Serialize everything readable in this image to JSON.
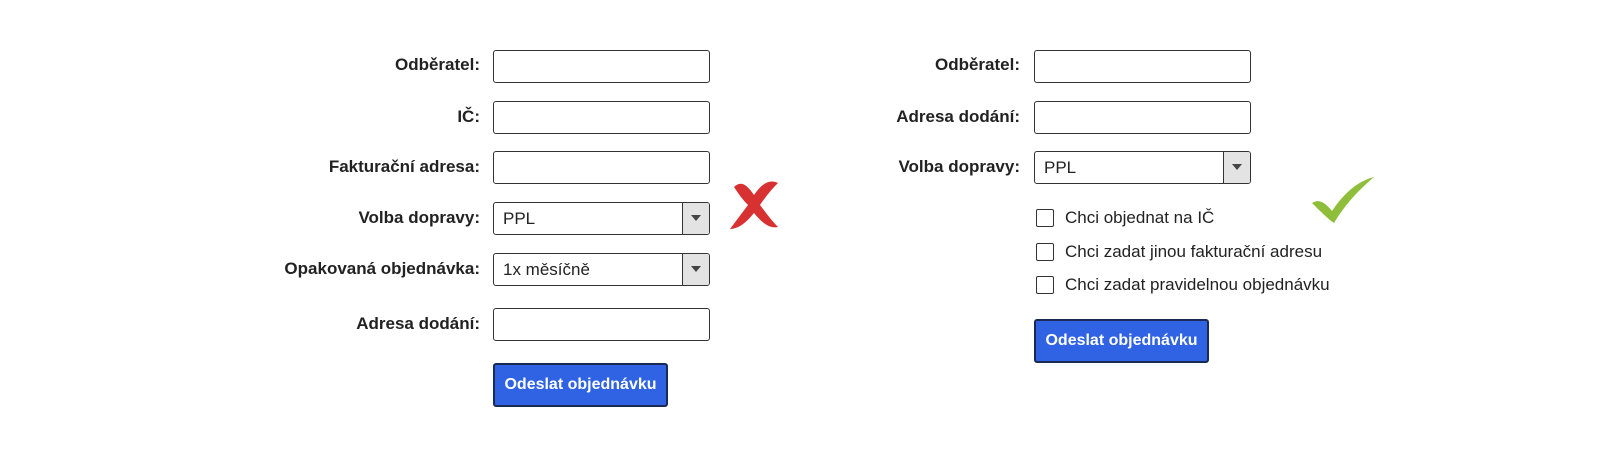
{
  "bad_form": {
    "fields": [
      {
        "label": "Odběratel:",
        "type": "text",
        "value": ""
      },
      {
        "label": "IČ:",
        "type": "text",
        "value": ""
      },
      {
        "label": "Fakturační adresa:",
        "type": "text",
        "value": ""
      },
      {
        "label": "Volba dopravy:",
        "type": "select",
        "value": "PPL"
      },
      {
        "label": "Opakovaná objednávka:",
        "type": "select",
        "value": "1x měsíčně"
      },
      {
        "label": "Adresa dodání:",
        "type": "text",
        "value": ""
      }
    ],
    "submit_label": "Odeslat objednávku",
    "verdict_icon": "red-x-icon"
  },
  "good_form": {
    "fields": [
      {
        "label": "Odběratel:",
        "type": "text",
        "value": ""
      },
      {
        "label": "Adresa dodání:",
        "type": "text",
        "value": ""
      },
      {
        "label": "Volba dopravy:",
        "type": "select",
        "value": "PPL"
      }
    ],
    "checkboxes": [
      {
        "label": "Chci objednat na IČ",
        "checked": false
      },
      {
        "label": "Chci zadat jinou fakturační adresu",
        "checked": false
      },
      {
        "label": "Chci zadat pravidelnou objednávku",
        "checked": false
      }
    ],
    "submit_label": "Odeslat objednávku",
    "verdict_icon": "green-check-icon"
  },
  "colors": {
    "button": "#2f63e3",
    "x_mark": "#d83131",
    "check_mark": "#8fbf3a"
  }
}
